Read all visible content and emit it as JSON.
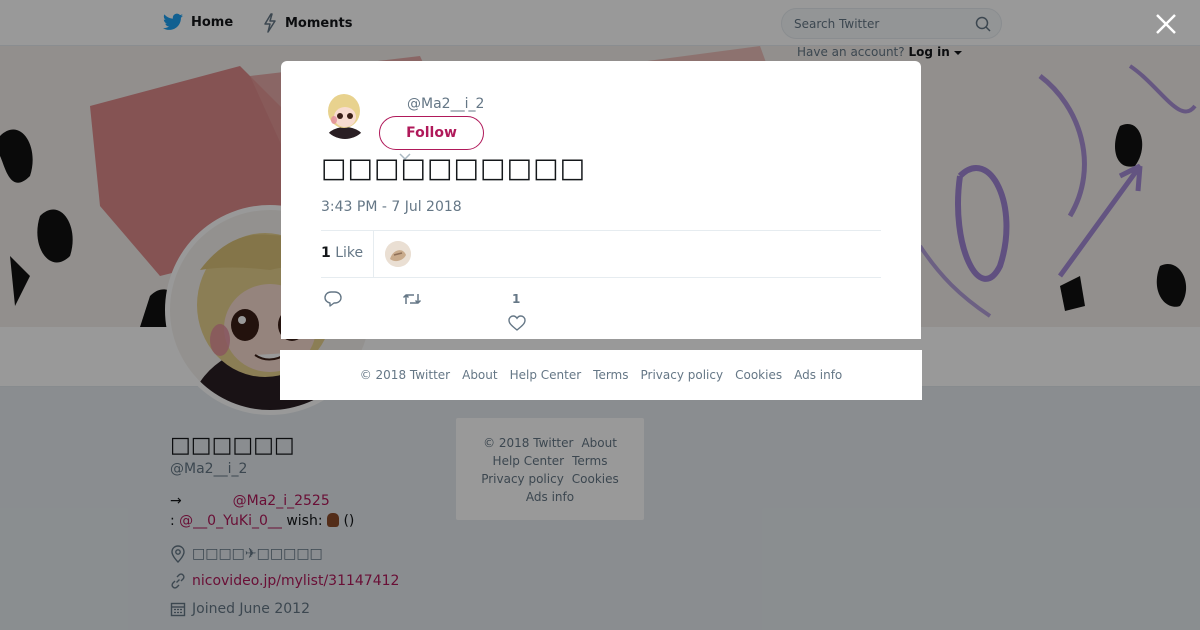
{
  "nav": {
    "home_label": "Home",
    "moments_label": "Moments",
    "search_placeholder": "Search Twitter",
    "account_prompt": "Have an account?",
    "login_label": "Log in"
  },
  "profile": {
    "name": "□□□□□□",
    "handle": "@Ma2__i_2",
    "bio_arrow": "→",
    "bio_link": "@Ma2_i_2525",
    "bio_prefix": ":",
    "bio_link2": "@__0_YuKi_0__",
    "bio_wish": "wish:",
    "bio_paren": "()",
    "location": "□□□□✈□□□□□",
    "website": "nicovideo.jp/mylist/31147412",
    "joined": "Joined June 2012"
  },
  "side_footer": {
    "copyright": "© 2018 Twitter",
    "about": "About",
    "help": "Help Center",
    "terms": "Terms",
    "privacy": "Privacy policy",
    "cookies": "Cookies",
    "ads": "Ads info"
  },
  "tweet": {
    "handle": "@Ma2__i_2",
    "follow_label": "Follow",
    "text": "□□□□□□□□□□",
    "timestamp": "3:43 PM - 7 Jul 2018",
    "like_count": "1",
    "like_word": "Like",
    "action_like_count": "1"
  },
  "modal_footer": {
    "copyright": "© 2018 Twitter",
    "about": "About",
    "help": "Help Center",
    "terms": "Terms",
    "privacy": "Privacy policy",
    "cookies": "Cookies",
    "ads": "Ads info"
  },
  "colors": {
    "accent": "#b0195a",
    "twitter_blue": "#1da1f2",
    "muted": "#657786"
  },
  "icons": [
    "twitter-bird-icon",
    "lightning-icon",
    "search-icon",
    "close-icon",
    "chevron-down-icon",
    "location-icon",
    "link-icon",
    "calendar-icon",
    "reply-icon",
    "retweet-icon",
    "heart-icon"
  ]
}
